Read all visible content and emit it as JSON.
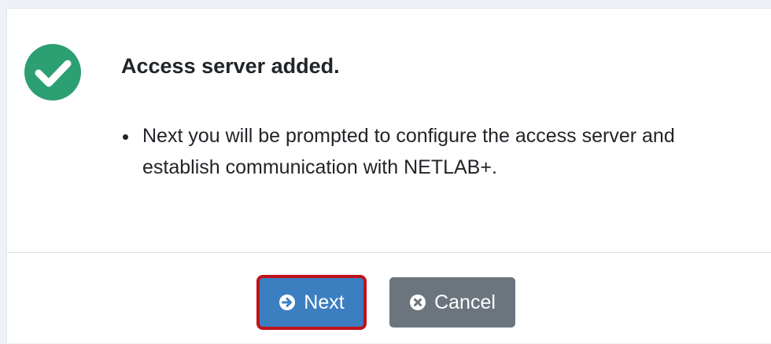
{
  "dialog": {
    "title": "Access server added.",
    "status_icon": "check-circle-icon",
    "status_color": "#2c9f73",
    "message_items": [
      "Next you will be prompted to configure the access server and establish communication with NETLAB+."
    ]
  },
  "footer": {
    "next": {
      "label": "Next",
      "icon": "arrow-circle-right-icon",
      "color": "#3c7fc1",
      "highlight_color": "#c0121b"
    },
    "cancel": {
      "label": "Cancel",
      "icon": "times-circle-icon",
      "color": "#6c757d"
    }
  }
}
